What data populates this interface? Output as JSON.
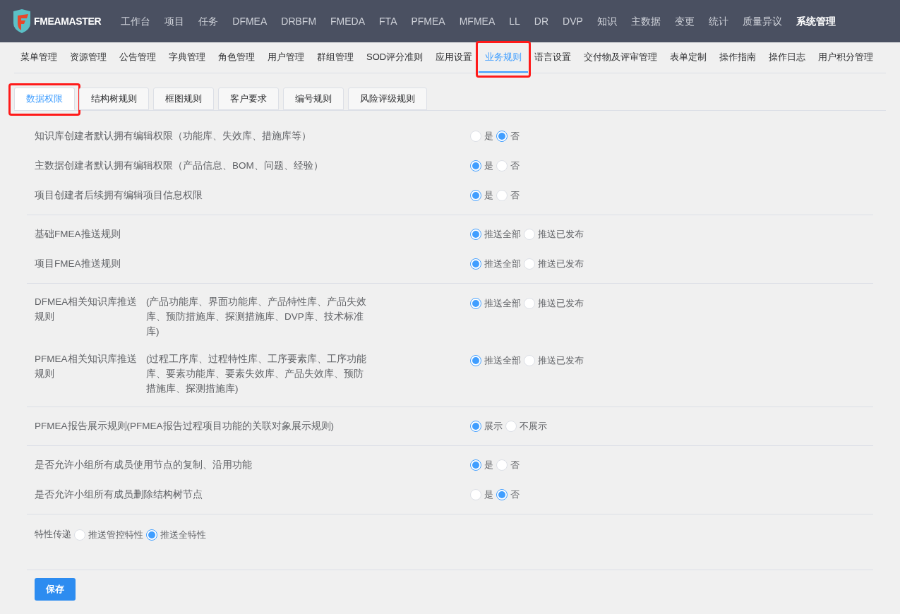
{
  "logo": {
    "text": "FMEAMASTER"
  },
  "top_nav": [
    {
      "label": "工作台",
      "selected": false
    },
    {
      "label": "项目",
      "selected": false
    },
    {
      "label": "任务",
      "selected": false
    },
    {
      "label": "DFMEA",
      "selected": false
    },
    {
      "label": "DRBFM",
      "selected": false
    },
    {
      "label": "FMEDA",
      "selected": false
    },
    {
      "label": "FTA",
      "selected": false
    },
    {
      "label": "PFMEA",
      "selected": false
    },
    {
      "label": "MFMEA",
      "selected": false
    },
    {
      "label": "LL",
      "selected": false
    },
    {
      "label": "DR",
      "selected": false
    },
    {
      "label": "DVP",
      "selected": false
    },
    {
      "label": "知识",
      "selected": false
    },
    {
      "label": "主数据",
      "selected": false
    },
    {
      "label": "变更",
      "selected": false
    },
    {
      "label": "统计",
      "selected": false
    },
    {
      "label": "质量异议",
      "selected": false
    },
    {
      "label": "系统管理",
      "selected": true
    }
  ],
  "sub_nav": [
    {
      "label": "菜单管理",
      "selected": false,
      "highlighted": false
    },
    {
      "label": "资源管理",
      "selected": false,
      "highlighted": false
    },
    {
      "label": "公告管理",
      "selected": false,
      "highlighted": false
    },
    {
      "label": "字典管理",
      "selected": false,
      "highlighted": false
    },
    {
      "label": "角色管理",
      "selected": false,
      "highlighted": false
    },
    {
      "label": "用户管理",
      "selected": false,
      "highlighted": false
    },
    {
      "label": "群组管理",
      "selected": false,
      "highlighted": false
    },
    {
      "label": "SOD评分准则",
      "selected": false,
      "highlighted": false
    },
    {
      "label": "应用设置",
      "selected": false,
      "highlighted": false
    },
    {
      "label": "业务规则",
      "selected": true,
      "highlighted": true
    },
    {
      "label": "语言设置",
      "selected": false,
      "highlighted": false
    },
    {
      "label": "交付物及评审管理",
      "selected": false,
      "highlighted": false
    },
    {
      "label": "表单定制",
      "selected": false,
      "highlighted": false
    },
    {
      "label": "操作指南",
      "selected": false,
      "highlighted": false
    },
    {
      "label": "操作日志",
      "selected": false,
      "highlighted": false
    },
    {
      "label": "用户积分管理",
      "selected": false,
      "highlighted": false
    }
  ],
  "tabs": [
    {
      "label": "数据权限",
      "selected": true,
      "highlighted": true
    },
    {
      "label": "结构树规则",
      "selected": false,
      "highlighted": false
    },
    {
      "label": "框图规则",
      "selected": false,
      "highlighted": false
    },
    {
      "label": "客户要求",
      "selected": false,
      "highlighted": false
    },
    {
      "label": "编号规则",
      "selected": false,
      "highlighted": false
    },
    {
      "label": "风险评级规则",
      "selected": false,
      "highlighted": false
    }
  ],
  "groups": [
    {
      "rows": [
        {
          "label": "知识库创建者默认拥有编辑权限（功能库、失效库、措施库等）",
          "options": [
            {
              "label": "是",
              "selected": false
            },
            {
              "label": "否",
              "selected": true
            }
          ]
        },
        {
          "label": "主数据创建者默认拥有编辑权限（产品信息、BOM、问题、经验）",
          "options": [
            {
              "label": "是",
              "selected": true
            },
            {
              "label": "否",
              "selected": false
            }
          ]
        },
        {
          "label": "项目创建者后续拥有编辑项目信息权限",
          "options": [
            {
              "label": "是",
              "selected": true
            },
            {
              "label": "否",
              "selected": false
            }
          ]
        }
      ]
    },
    {
      "rows": [
        {
          "label": "基础FMEA推送规则",
          "options": [
            {
              "label": "推送全部",
              "selected": true
            },
            {
              "label": "推送已发布",
              "selected": false
            }
          ]
        },
        {
          "label": "项目FMEA推送规则",
          "options": [
            {
              "label": "推送全部",
              "selected": true
            },
            {
              "label": "推送已发布",
              "selected": false
            }
          ]
        }
      ]
    },
    {
      "rows": [
        {
          "label": "DFMEA相关知识库推送规则",
          "note": "(产品功能库、界面功能库、产品特性库、产品失效库、预防措施库、探测措施库、DVP库、技术标准库)",
          "options": [
            {
              "label": "推送全部",
              "selected": true
            },
            {
              "label": "推送已发布",
              "selected": false
            }
          ]
        },
        {
          "label": "PFMEA相关知识库推送规则",
          "note": "(过程工序库、过程特性库、工序要素库、工序功能库、要素功能库、要素失效库、产品失效库、预防措施库、探测措施库)",
          "options": [
            {
              "label": "推送全部",
              "selected": true
            },
            {
              "label": "推送已发布",
              "selected": false
            }
          ]
        }
      ]
    },
    {
      "rows": [
        {
          "label": "PFMEA报告展示规则(PFMEA报告过程项目功能的关联对象展示规则)",
          "options": [
            {
              "label": "展示",
              "selected": true
            },
            {
              "label": "不展示",
              "selected": false
            }
          ]
        }
      ]
    },
    {
      "rows": [
        {
          "label": "是否允许小组所有成员使用节点的复制、沿用功能",
          "options": [
            {
              "label": "是",
              "selected": true
            },
            {
              "label": "否",
              "selected": false
            }
          ]
        },
        {
          "label": "是否允许小组所有成员删除结构树节点",
          "options": [
            {
              "label": "是",
              "selected": false
            },
            {
              "label": "否",
              "selected": true
            }
          ]
        }
      ]
    }
  ],
  "characteristic": {
    "label": "特性传递",
    "options": [
      {
        "label": "推送管控特性",
        "selected": false
      },
      {
        "label": "推送全特性",
        "selected": true
      }
    ]
  },
  "save_button": {
    "label": "保存"
  }
}
